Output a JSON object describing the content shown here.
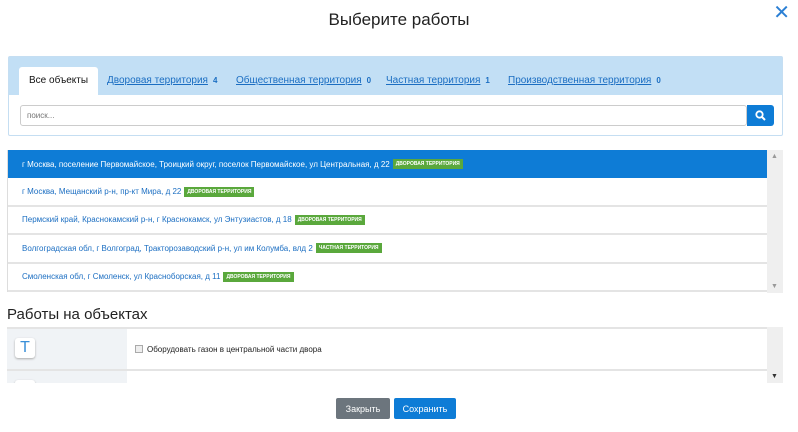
{
  "title": "Выберите работы",
  "tabs": [
    {
      "label": "Все объекты",
      "count": ""
    },
    {
      "label": "Дворовая территория",
      "count": "4"
    },
    {
      "label": "Общественная территория",
      "count": "0"
    },
    {
      "label": "Частная территория",
      "count": "1"
    },
    {
      "label": "Производственная территория",
      "count": "0"
    }
  ],
  "search": {
    "placeholder": "поиск..."
  },
  "objects": [
    {
      "address": "г Москва, поселение Первомайское, Троицкий округ, поселок Первомайское, ул Центральная, д 22",
      "badge": "Дворовая территория"
    },
    {
      "address": "г Москва, Мещанский р-н, пр-кт Мира, д 22",
      "badge": "Дворовая территория"
    },
    {
      "address": "Пермский край, Краснокамский р-н, г Краснокамск, ул Энтузиастов, д 18",
      "badge": "Дворовая территория"
    },
    {
      "address": "Волгоградская обл, г Волгоград, Тракторозаводский р-н, ул им Колумба, влд 2",
      "badge": "Частная территория"
    },
    {
      "address": "Смоленская обл, г Смоленск, ул Красноборская, д 11",
      "badge": "Дворовая территория"
    }
  ],
  "works_heading": "Работы на объектах",
  "works": [
    {
      "label": "Оборудовать газон в центральной части двора"
    }
  ],
  "buttons": {
    "close": "Закрыть",
    "save": "Сохранить"
  },
  "colors": {
    "primary": "#0e7cd6",
    "badge": "#5aa83c",
    "secondary": "#6c757d"
  }
}
